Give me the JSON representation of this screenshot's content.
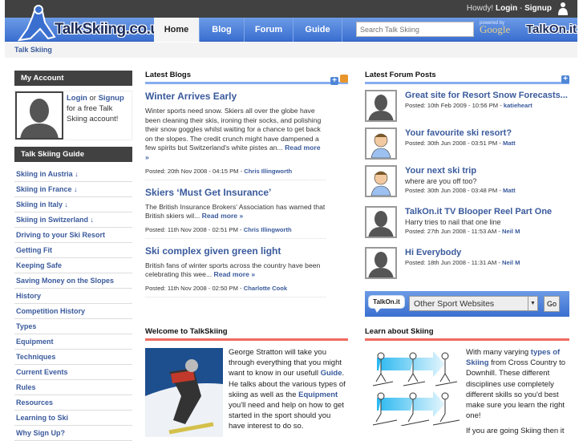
{
  "header": {
    "howdy": "Howdy!",
    "login": "Login",
    "separator": "-",
    "signup": "Signup",
    "logo": "TalkSkiing.co.uk",
    "search_placeholder": "Search Talk Skiing",
    "powered_by": "powered by",
    "google": "Google",
    "talkon": "TalkOn.it"
  },
  "nav": {
    "tabs": [
      {
        "label": "Home"
      },
      {
        "label": "Blog"
      },
      {
        "label": "Forum"
      },
      {
        "label": "Guide"
      }
    ]
  },
  "breadcrumb": "Talk Skiing",
  "account": {
    "title": "My Account",
    "login": "Login",
    "or": "or",
    "signup": "Signup",
    "text": "for a free Talk Skiing account!"
  },
  "guide": {
    "title": "Talk Skiing Guide",
    "links": [
      "Skiing in Austria ↓",
      "Skiing in France ↓",
      "Skiing in Italy ↓",
      "Skiing in Switzerland ↓",
      "Driving to your Ski Resort",
      "Getting Fit",
      "Keeping Safe",
      "Saving Money on the Slopes",
      "History",
      "Competition History",
      "Types",
      "Equipment",
      "Techniques",
      "Current Events",
      "Rules",
      "Resources",
      "Learning to Ski",
      "Why Sign Up?"
    ]
  },
  "blogs": {
    "title": "Latest Blogs",
    "read_more": "Read more »",
    "items": [
      {
        "title": "Winter Arrives Early",
        "excerpt": "Winter sports need snow. Skiers all over the globe have been cleaning their skis, ironing their socks, and polishing their snow goggles whilst waiting for a chance to get back on the slopes. The credit crunch might have dampened a few spirits but Switzerland's white pistes an...",
        "posted": "Posted: 20th Nov 2008 - 04:15 PM -",
        "author": "Chris Illingworth"
      },
      {
        "title": "Skiers ‘Must Get Insurance’",
        "excerpt": "The British Insurance Brokers' Association has warned that British skiers wil...",
        "posted": "Posted: 11th Nov 2008 - 02:51 PM -",
        "author": "Chris Illingworth"
      },
      {
        "title": "Ski complex given green light",
        "excerpt": "British fans of winter sports across the country have been celebrating this wee...",
        "posted": "Posted: 11th Nov 2008 - 02:50 PM -",
        "author": "Charlotte Cook"
      }
    ]
  },
  "forum": {
    "title": "Latest Forum Posts",
    "items": [
      {
        "title": "Great site for Resort Snow Forecasts...",
        "sub": null,
        "posted": "Posted: 10th Feb 2009 - 10:56 PM -",
        "author": "katieheart",
        "avatar": "silhouette"
      },
      {
        "title": "Your favourite ski resort?",
        "sub": null,
        "posted": "Posted: 30th Jun 2008 - 03:51 PM -",
        "author": "Matt",
        "avatar": "cartoon"
      },
      {
        "title": "Your next ski trip",
        "sub": "where are you off too?",
        "posted": "Posted: 30th Jun 2008 - 03:48 PM -",
        "author": "Matt",
        "avatar": "cartoon"
      },
      {
        "title": "TalkOn.it TV Blooper Reel Part One",
        "sub": "Harry tries to nail that one line",
        "posted": "Posted: 27th Jun 2008 - 11:53 AM -",
        "author": "Neil M",
        "avatar": "silhouette"
      },
      {
        "title": "Hi Everybody",
        "sub": null,
        "posted": "Posted: 18th Jun 2008 - 11:31 AM -",
        "author": "Neil M",
        "avatar": "silhouette"
      }
    ]
  },
  "sites": {
    "selected": "Other Sport Websites",
    "go": "Go",
    "badge": "TalkOn.it"
  },
  "welcome": {
    "title": "Welcome to TalkSkiing",
    "t1": "George Stratton will take you through everything that you might want to know in our usefull ",
    "guide": "Guide",
    "t2": ". He talks about the various types of skiing as well as the ",
    "equipment": "Equipment",
    "t3": " you'll need and help on how to get started in the sport should you have interest to do so."
  },
  "learn": {
    "title": "Learn about Skiing",
    "t1": "With many varying ",
    "link": "types of Skiing",
    "t2": " from Cross Country to Downhill. These different disciplines use completely different skills so you'd best make sure you learn the right one!",
    "p2": "If you are going Skiing then it"
  }
}
